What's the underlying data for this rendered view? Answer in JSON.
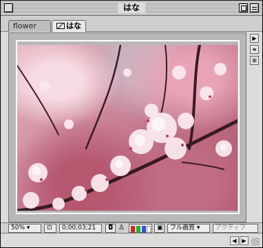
{
  "window": {
    "title": "はな"
  },
  "tabs": [
    {
      "label": "flower"
    },
    {
      "label": "はな"
    }
  ],
  "side_buttons": [
    {
      "icon": "play-arrow-icon",
      "glyph": "▶"
    },
    {
      "icon": "comp-menu-icon",
      "glyph": "≡"
    },
    {
      "icon": "flowchart-icon",
      "glyph": "⊞"
    }
  ],
  "controls": {
    "zoom": "50%",
    "region_icon": "region-of-interest-icon",
    "timecode": "0;00;03;21",
    "snapshot_icon": "camera-icon",
    "show_snapshot_icon": "person-icon",
    "channels": {
      "red": "#e02020",
      "green": "#20b020",
      "blue": "#3050e0",
      "alpha": "#ffffff"
    },
    "grid_icon": "grid-icon",
    "resolution": "フル画質",
    "camera": "アクティブ"
  },
  "colors": {
    "window_bg": "#dcdcdc",
    "comp_bg": "#b8b8b8",
    "safe_frame": "#ffffff"
  }
}
